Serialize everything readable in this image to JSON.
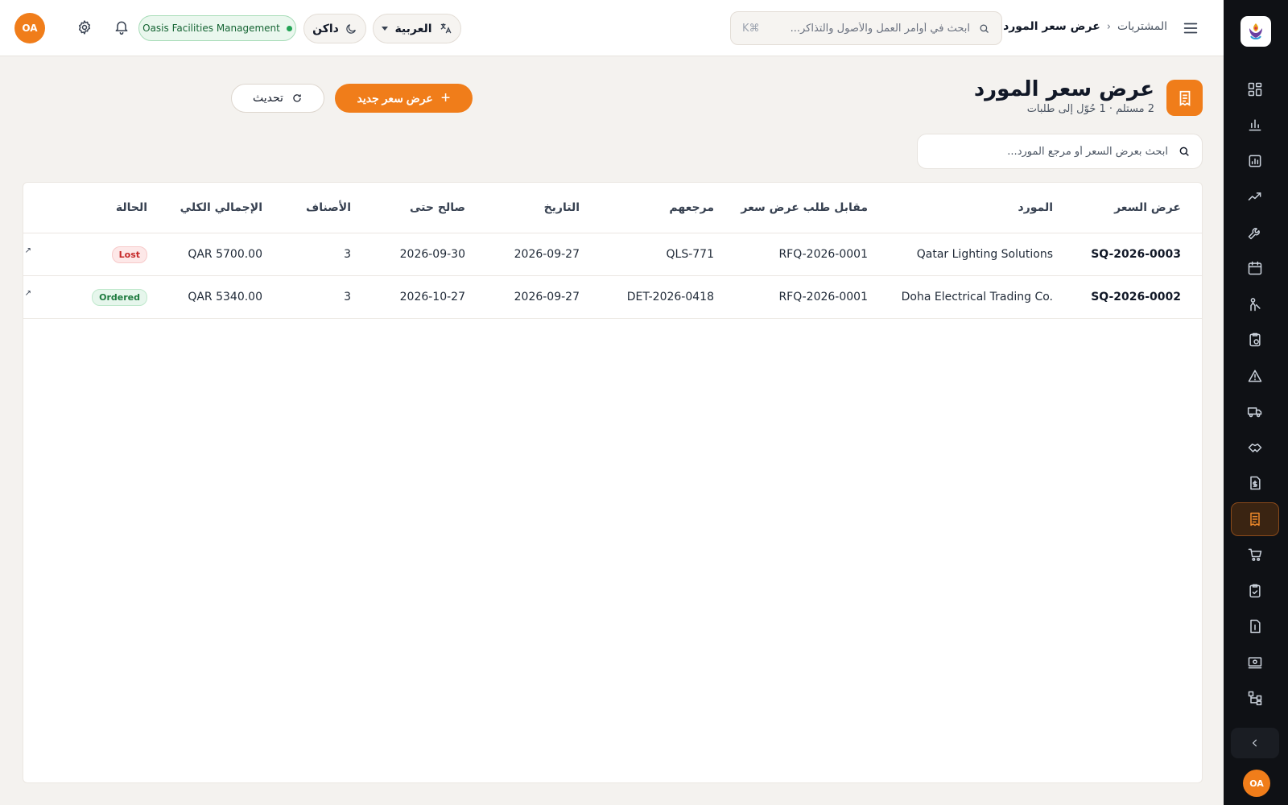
{
  "app": {
    "org_name": "Oasis Facilities Management",
    "user_initials": "OA",
    "accent_color": "#f07d1a"
  },
  "header": {
    "breadcrumb_parent": "المشتريات",
    "breadcrumb_current": "عرض سعر المورد",
    "search_placeholder": "ابحث في أوامر العمل والأصول والتذاكر...",
    "search_shortcut": "⌘K",
    "language_label": "العربية",
    "theme_label": "داكن"
  },
  "sidebar": {
    "items": [
      {
        "icon": "dashboard-grid-icon"
      },
      {
        "icon": "bar-chart-icon"
      },
      {
        "icon": "reports-icon"
      },
      {
        "icon": "trend-line-icon"
      },
      {
        "icon": "wrench-icon"
      },
      {
        "icon": "calendar-icon"
      },
      {
        "icon": "technician-icon"
      },
      {
        "icon": "clipboard-clock-icon"
      },
      {
        "icon": "warning-triangle-icon"
      },
      {
        "icon": "truck-icon"
      },
      {
        "icon": "handshake-icon"
      },
      {
        "icon": "invoice-dollar-icon"
      },
      {
        "icon": "supplier-quote-icon",
        "active": true
      },
      {
        "icon": "cart-icon"
      },
      {
        "icon": "clipboard-check-icon"
      },
      {
        "icon": "document-dollar-icon"
      },
      {
        "icon": "payment-icon"
      },
      {
        "icon": "hierarchy-icon"
      }
    ]
  },
  "page": {
    "title": "عرض سعر المورد",
    "subtitle": "2 مستلم · 1 حُوّل إلى طلبات",
    "refresh_label": "تحديث",
    "new_label": "عرض سعر جديد",
    "search_placeholder": "ابحث بعرض السعر أو مرجع المورد..."
  },
  "table": {
    "columns": {
      "quote": "عرض السعر",
      "supplier": "المورد",
      "rfq": "مقابل طلب عرض سعر",
      "their_ref": "مرجعهم",
      "date": "التاريخ",
      "valid_until": "صالح حتى",
      "items": "الأصناف",
      "total": "الإجمالي الكلي",
      "status": "الحالة"
    },
    "rows": [
      {
        "quote": "SQ-2026-0003",
        "supplier": "Qatar Lighting Solutions",
        "rfq": "RFQ-2026-0001",
        "their_ref": "QLS-771",
        "date": "2026-09-27",
        "valid_until": "2026-09-30",
        "items": "3",
        "total": "QAR 5700.00",
        "status": "Lost"
      },
      {
        "quote": "SQ-2026-0002",
        "supplier": "Doha Electrical Trading Co.",
        "rfq": "RFQ-2026-0001",
        "their_ref": "DET-2026-0418",
        "date": "2026-09-27",
        "valid_until": "2026-10-27",
        "items": "3",
        "total": "QAR 5340.00",
        "status": "Ordered"
      }
    ]
  }
}
